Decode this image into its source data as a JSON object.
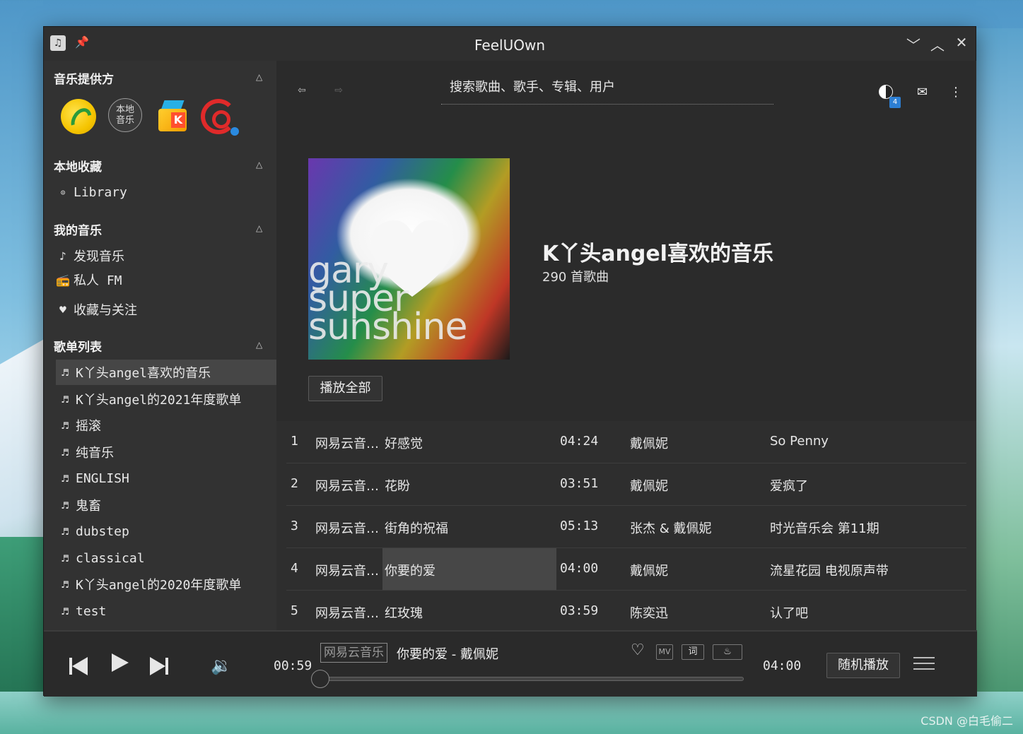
{
  "window": {
    "title": "FeelUOwn"
  },
  "sidebar": {
    "providers_header": "音乐提供方",
    "local_music_label": "本地\n音乐",
    "collections_header": "本地收藏",
    "library_label": "Library",
    "my_music_header": "我的音乐",
    "my_music_items": [
      {
        "icon": "note-icon",
        "label": "发现音乐"
      },
      {
        "icon": "radio-icon",
        "label": "私人 FM"
      },
      {
        "icon": "heart-icon",
        "label": "收藏与关注"
      }
    ],
    "playlists_header": "歌单列表",
    "playlists": [
      "K丫头angel喜欢的音乐",
      "K丫头angel的2021年度歌单",
      "摇滚",
      "纯音乐",
      "ENGLISH",
      "鬼畜",
      "dubstep",
      "classical",
      "K丫头angel的2020年度歌单",
      "test"
    ],
    "active_playlist_index": 0
  },
  "toolbar": {
    "search_placeholder": "搜索歌曲、歌手、专辑、用户",
    "notification_count": "4"
  },
  "playlist": {
    "cover_text": [
      "gary",
      "super",
      "sunshine"
    ],
    "title": "K丫头angel喜欢的音乐",
    "count_label": "290 首歌曲",
    "play_all_label": "播放全部"
  },
  "tracks": [
    {
      "num": "1",
      "source": "网易云音…",
      "title": "好感觉",
      "duration": "04:24",
      "artist": "戴佩妮",
      "album": "So Penny"
    },
    {
      "num": "2",
      "source": "网易云音…",
      "title": "花盼",
      "duration": "03:51",
      "artist": "戴佩妮",
      "album": "爱疯了"
    },
    {
      "num": "3",
      "source": "网易云音…",
      "title": "街角的祝福",
      "duration": "05:13",
      "artist": "张杰 & 戴佩妮",
      "album": "时光音乐会 第11期"
    },
    {
      "num": "4",
      "source": "网易云音…",
      "title": "你要的爱",
      "duration": "04:00",
      "artist": "戴佩妮",
      "album": "流星花园 电视原声带"
    },
    {
      "num": "5",
      "source": "网易云音…",
      "title": "红玫瑰",
      "duration": "03:59",
      "artist": "陈奕迅",
      "album": "认了吧"
    }
  ],
  "player": {
    "position": "00:59",
    "duration": "04:00",
    "source": "网易云音乐",
    "now_playing": "你要的爱 - 戴佩妮",
    "mv_label": "MV",
    "lyric_label": "词",
    "play_mode": "随机播放",
    "progress_fraction": 0.0
  },
  "watermark": "CSDN @白毛偷二"
}
